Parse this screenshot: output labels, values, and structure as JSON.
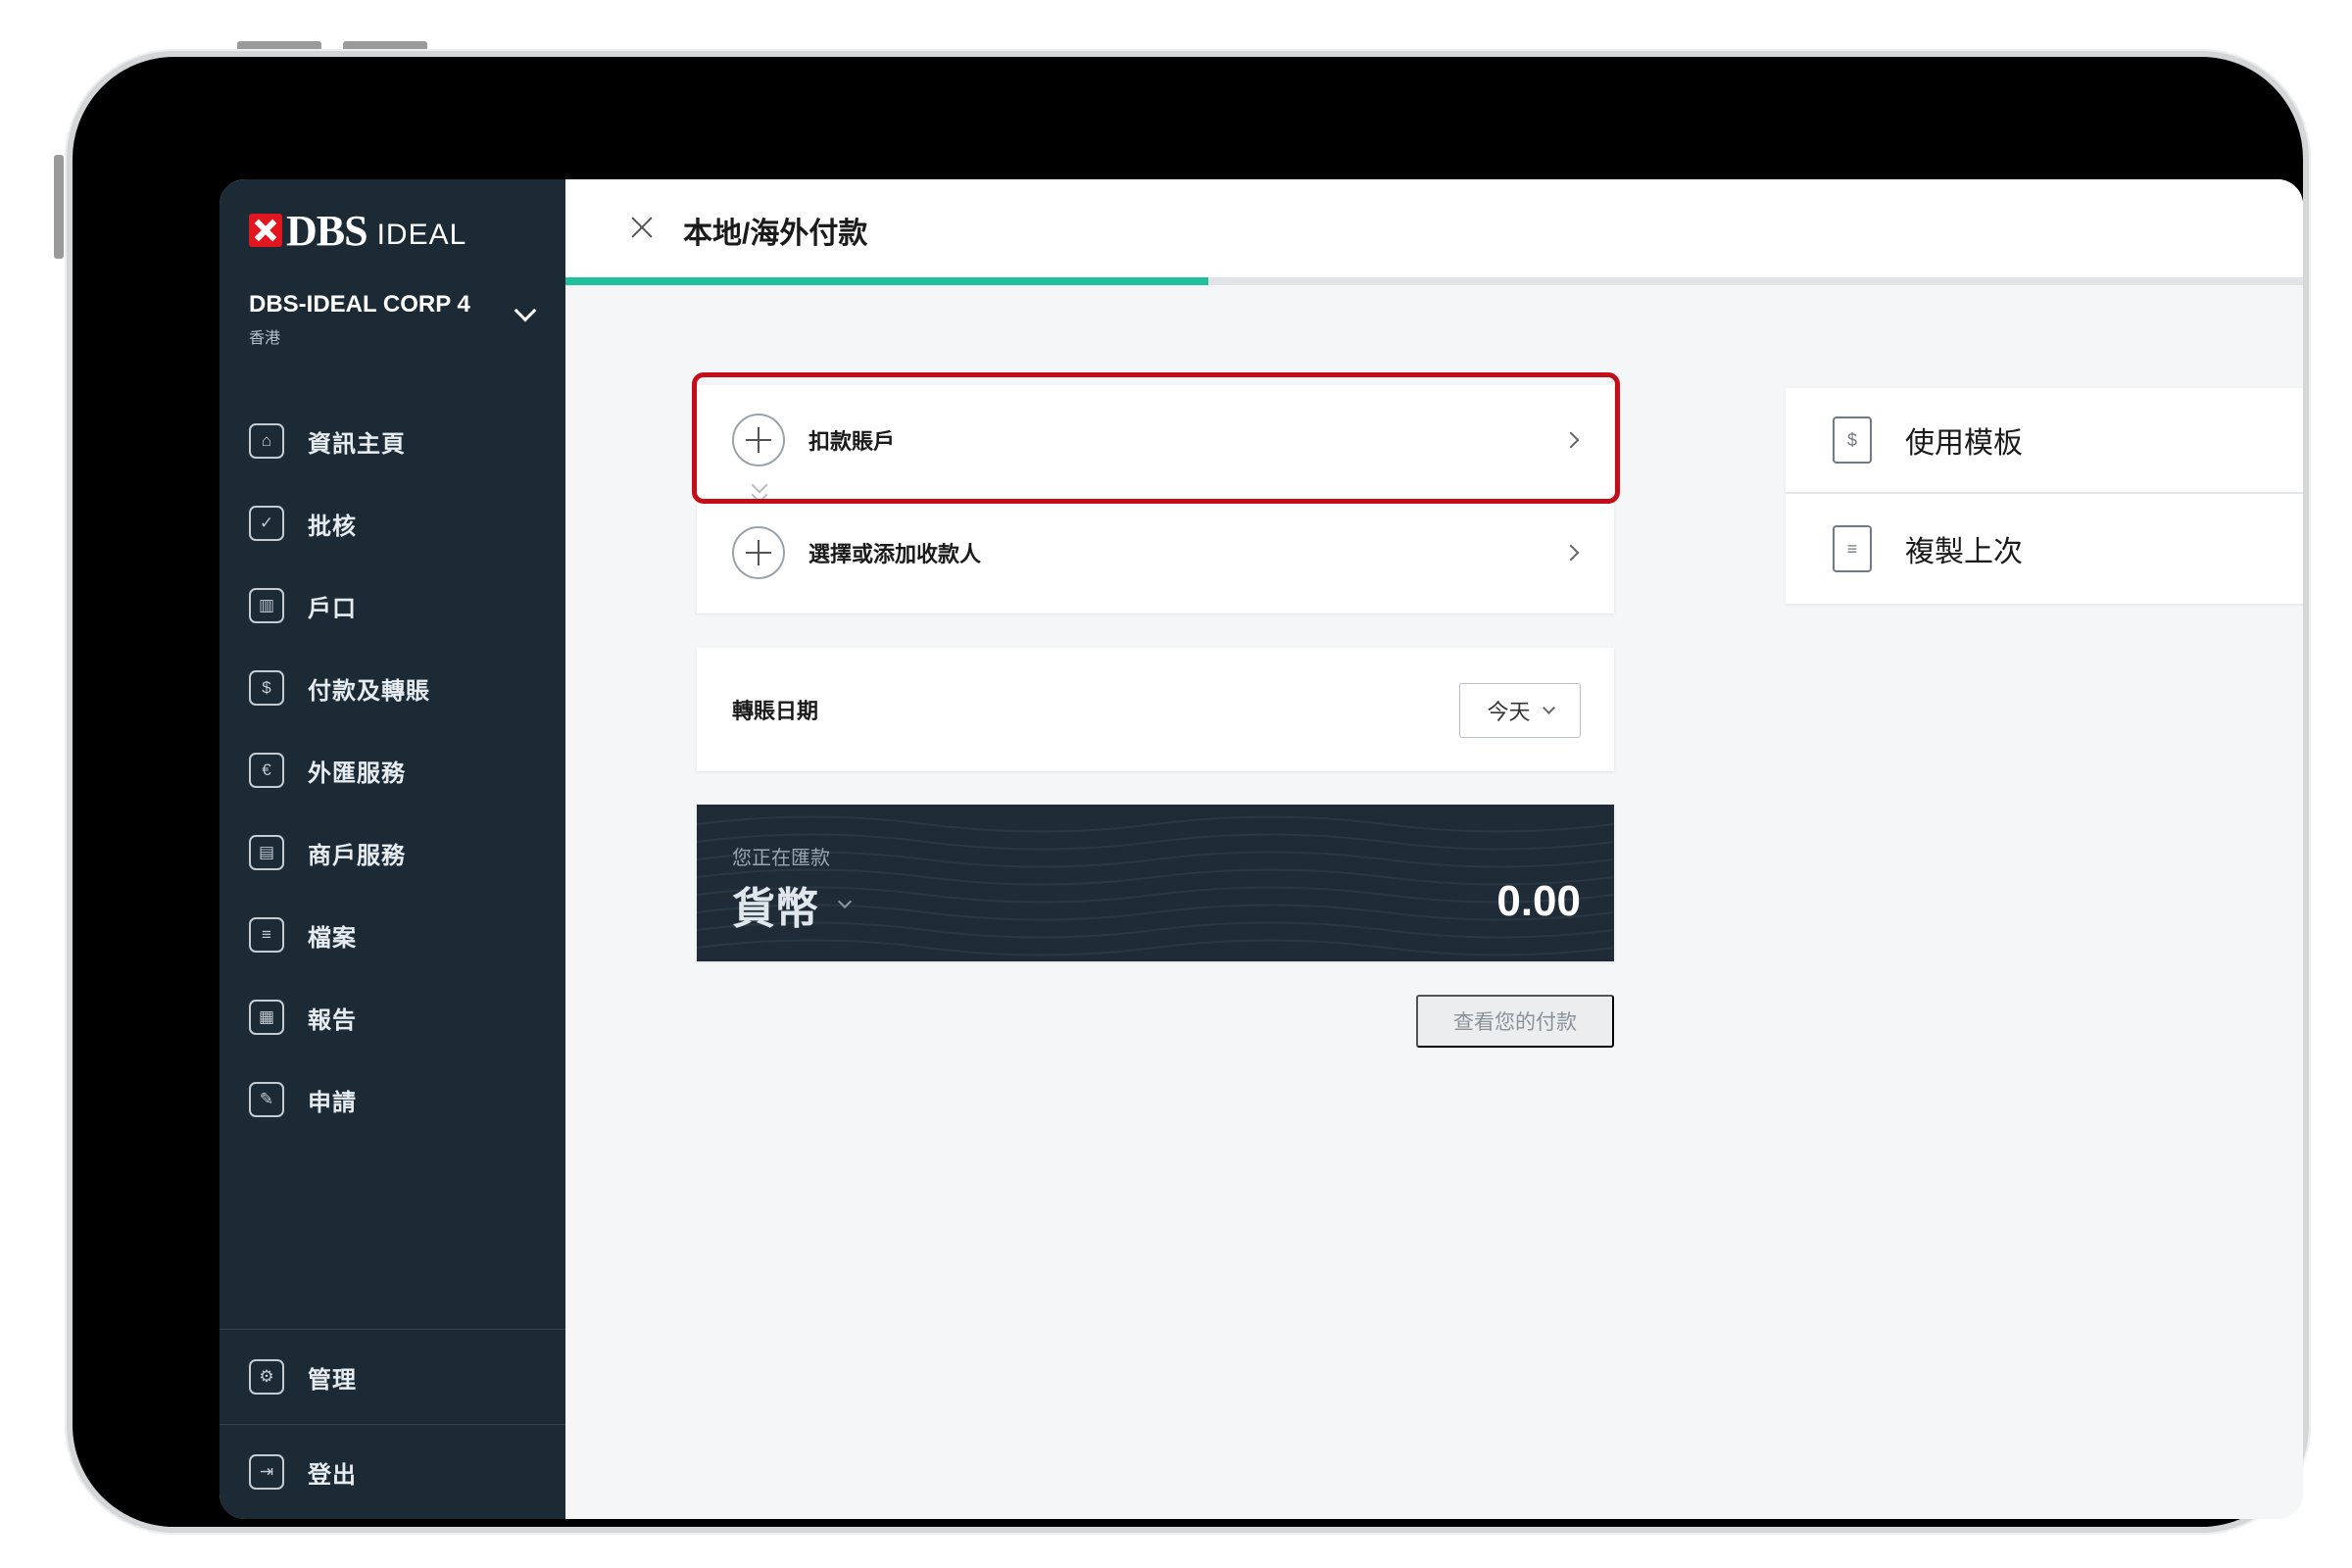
{
  "app": {
    "brand": "DBS",
    "brand_sub": "IDEAL"
  },
  "org": {
    "name": "DBS-IDEAL CORP 4",
    "region": "香港"
  },
  "sidebar": {
    "items": [
      {
        "label": "資訊主頁",
        "icon": "home-icon",
        "glyph": "⌂"
      },
      {
        "label": "批核",
        "icon": "approval-icon",
        "glyph": "✓"
      },
      {
        "label": "戶口",
        "icon": "bank-icon",
        "glyph": "▥"
      },
      {
        "label": "付款及轉賬",
        "icon": "transfer-icon",
        "glyph": "$"
      },
      {
        "label": "外匯服務",
        "icon": "fx-icon",
        "glyph": "€"
      },
      {
        "label": "商戶服務",
        "icon": "merchant-icon",
        "glyph": "▤"
      },
      {
        "label": "檔案",
        "icon": "file-icon",
        "glyph": "≡"
      },
      {
        "label": "報告",
        "icon": "report-icon",
        "glyph": "▦"
      },
      {
        "label": "申請",
        "icon": "application-icon",
        "glyph": "✎"
      }
    ],
    "bottom": [
      {
        "label": "管理",
        "icon": "gear-icon",
        "glyph": "⚙"
      },
      {
        "label": "登出",
        "icon": "logout-icon",
        "glyph": "⇥"
      }
    ]
  },
  "header": {
    "title": "本地/海外付款",
    "progress": 0.37
  },
  "form": {
    "debit_account_label": "扣款賬戶",
    "payee_label": "選擇或添加收款人",
    "transfer_date_label": "轉賬日期",
    "transfer_date_value": "今天",
    "amount_caption": "您正在匯款",
    "currency_label": "貨幣",
    "amount_value": "0.00",
    "view_payments_label": "查看您的付款"
  },
  "quick_actions": {
    "use_template_label": "使用模板",
    "copy_last_label": "複製上次"
  },
  "colors": {
    "sidebar_bg": "#1c2a36",
    "accent": "#1ec19c",
    "highlight": "#c40d17",
    "brand_red": "#e1161e",
    "amount_card_bg": "#1f2b37"
  }
}
